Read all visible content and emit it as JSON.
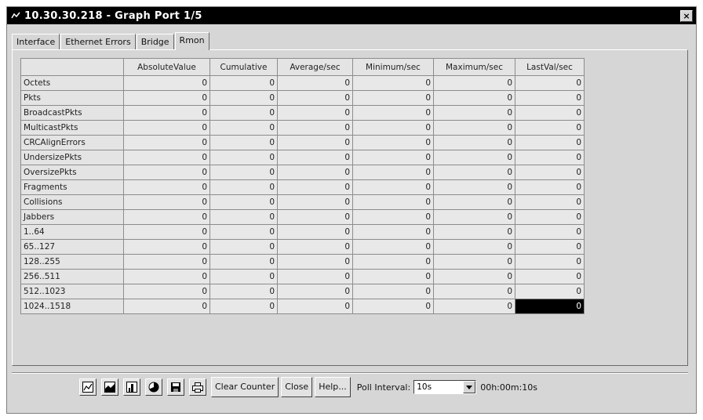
{
  "window": {
    "title": "10.30.30.218 - Graph Port 1/5",
    "close_glyph": "×"
  },
  "tabs": [
    {
      "label": "Interface",
      "active": false
    },
    {
      "label": "Ethernet Errors",
      "active": false
    },
    {
      "label": "Bridge",
      "active": false
    },
    {
      "label": "Rmon",
      "active": true
    }
  ],
  "table": {
    "columns": [
      "AbsoluteValue",
      "Cumulative",
      "Average/sec",
      "Minimum/sec",
      "Maximum/sec",
      "LastVal/sec"
    ],
    "rows": [
      {
        "name": "Octets",
        "values": [
          "0",
          "0",
          "0",
          "0",
          "0",
          "0"
        ]
      },
      {
        "name": "Pkts",
        "values": [
          "0",
          "0",
          "0",
          "0",
          "0",
          "0"
        ]
      },
      {
        "name": "BroadcastPkts",
        "values": [
          "0",
          "0",
          "0",
          "0",
          "0",
          "0"
        ]
      },
      {
        "name": "MulticastPkts",
        "values": [
          "0",
          "0",
          "0",
          "0",
          "0",
          "0"
        ]
      },
      {
        "name": "CRCAlignErrors",
        "values": [
          "0",
          "0",
          "0",
          "0",
          "0",
          "0"
        ]
      },
      {
        "name": "UndersizePkts",
        "values": [
          "0",
          "0",
          "0",
          "0",
          "0",
          "0"
        ]
      },
      {
        "name": "OversizePkts",
        "values": [
          "0",
          "0",
          "0",
          "0",
          "0",
          "0"
        ]
      },
      {
        "name": "Fragments",
        "values": [
          "0",
          "0",
          "0",
          "0",
          "0",
          "0"
        ]
      },
      {
        "name": "Collisions",
        "values": [
          "0",
          "0",
          "0",
          "0",
          "0",
          "0"
        ]
      },
      {
        "name": "Jabbers",
        "values": [
          "0",
          "0",
          "0",
          "0",
          "0",
          "0"
        ]
      },
      {
        "name": "1..64",
        "values": [
          "0",
          "0",
          "0",
          "0",
          "0",
          "0"
        ]
      },
      {
        "name": "65..127",
        "values": [
          "0",
          "0",
          "0",
          "0",
          "0",
          "0"
        ]
      },
      {
        "name": "128..255",
        "values": [
          "0",
          "0",
          "0",
          "0",
          "0",
          "0"
        ]
      },
      {
        "name": "256..511",
        "values": [
          "0",
          "0",
          "0",
          "0",
          "0",
          "0"
        ]
      },
      {
        "name": "512..1023",
        "values": [
          "0",
          "0",
          "0",
          "0",
          "0",
          "0"
        ]
      },
      {
        "name": "1024..1518",
        "values": [
          "0",
          "0",
          "0",
          "0",
          "0",
          "0"
        ],
        "selected_column": 5
      }
    ]
  },
  "toolbar": {
    "icons": [
      "line-chart-icon",
      "area-chart-icon",
      "bar-chart-icon",
      "pie-chart-icon",
      "save-icon",
      "print-icon"
    ],
    "clear_counter": "Clear Counter",
    "close": "Close",
    "help": "Help...",
    "poll_label": "Poll Interval:",
    "poll_value": "10s",
    "elapsed": "00h:00m:10s"
  }
}
